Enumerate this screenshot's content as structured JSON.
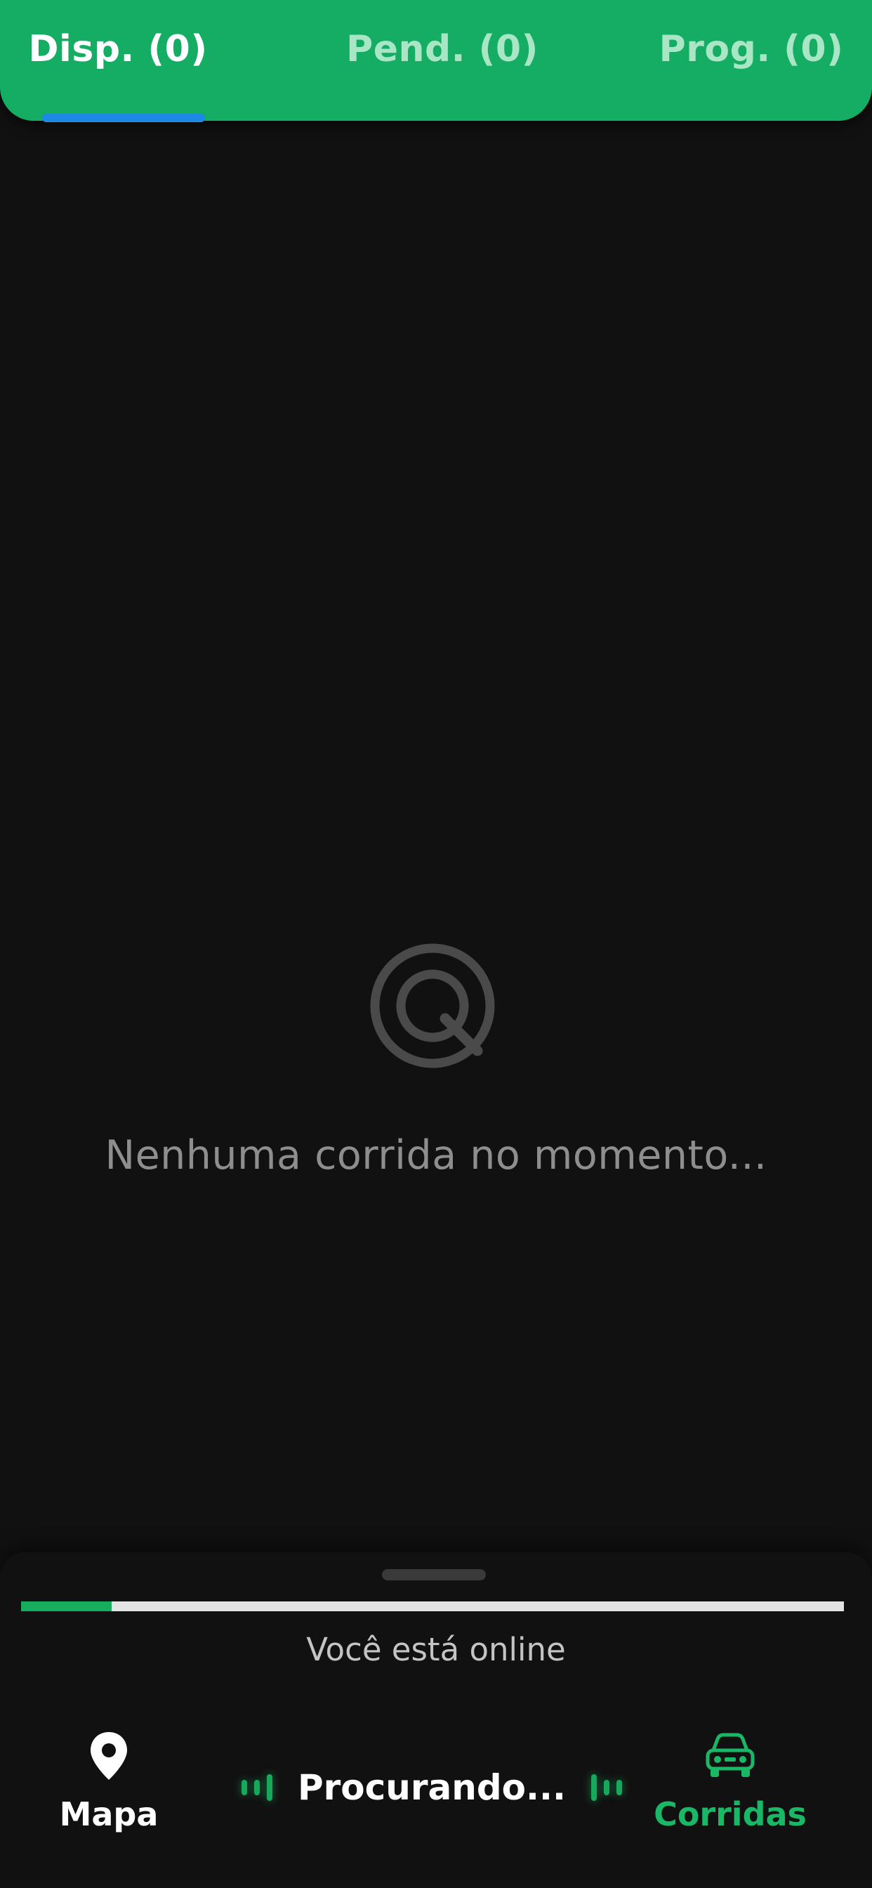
{
  "tabs": {
    "available": {
      "label": "Disp. (0)"
    },
    "pending": {
      "label": "Pend. (0)"
    },
    "scheduled": {
      "label": "Prog. (0)"
    }
  },
  "empty_state": {
    "message": "Nenhuma corrida no momento...",
    "icon": "radar-search-icon"
  },
  "status": {
    "online_text": "Você está online",
    "progress_fraction": 0.11
  },
  "bottom_nav": {
    "map_label": "Mapa",
    "map_icon": "location-pin-icon",
    "searching_label": "Procurando...",
    "rides_label": "Corridas",
    "rides_icon": "car-icon"
  },
  "colors": {
    "brand_green": "#14ad63",
    "active_tab_indicator": "#1e88e5",
    "background": "#111111",
    "nav_active": "#1ab866"
  }
}
